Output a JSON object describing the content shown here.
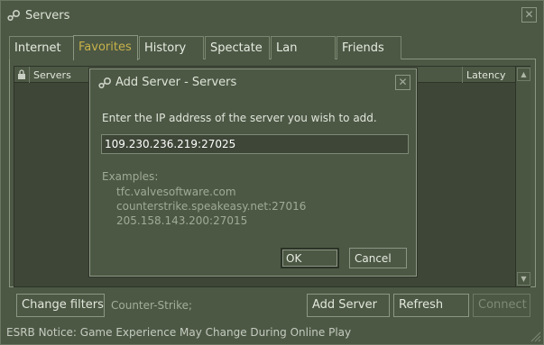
{
  "window": {
    "title": "Servers",
    "close_glyph": "✕"
  },
  "tabs": [
    {
      "label": "Internet",
      "active": false
    },
    {
      "label": "Favorites",
      "active": true
    },
    {
      "label": "History",
      "active": false
    },
    {
      "label": "Spectate",
      "active": false
    },
    {
      "label": "Lan",
      "active": false
    },
    {
      "label": "Friends",
      "active": false
    }
  ],
  "list": {
    "columns": [
      "Servers",
      "Latency"
    ],
    "scroll_up": "▲",
    "scroll_down": "▼"
  },
  "footer": {
    "change_filters": "Change filters",
    "filter_text": "Counter-Strike;",
    "add_server": "Add Server",
    "refresh": "Refresh",
    "connect": "Connect"
  },
  "status": "ESRB Notice: Game Experience May Change During Online Play",
  "dialog": {
    "title": "Add Server - Servers",
    "close_glyph": "✕",
    "prompt": "Enter the IP address of the server you wish to add.",
    "input_value": "109.230.236.219:27025",
    "examples_label": "Examples:",
    "examples": [
      "tfc.valvesoftware.com",
      "counterstrike.speakeasy.net:27016",
      "205.158.143.200:27015"
    ],
    "ok": "OK",
    "cancel": "Cancel"
  },
  "icons": {
    "app": "steam-icon",
    "lock": "lock-icon",
    "grip": "resize-grip-icon"
  },
  "colors": {
    "background": "#4c5844",
    "active_tab_text": "#c7b14a",
    "list_bg": "#3e4637"
  }
}
